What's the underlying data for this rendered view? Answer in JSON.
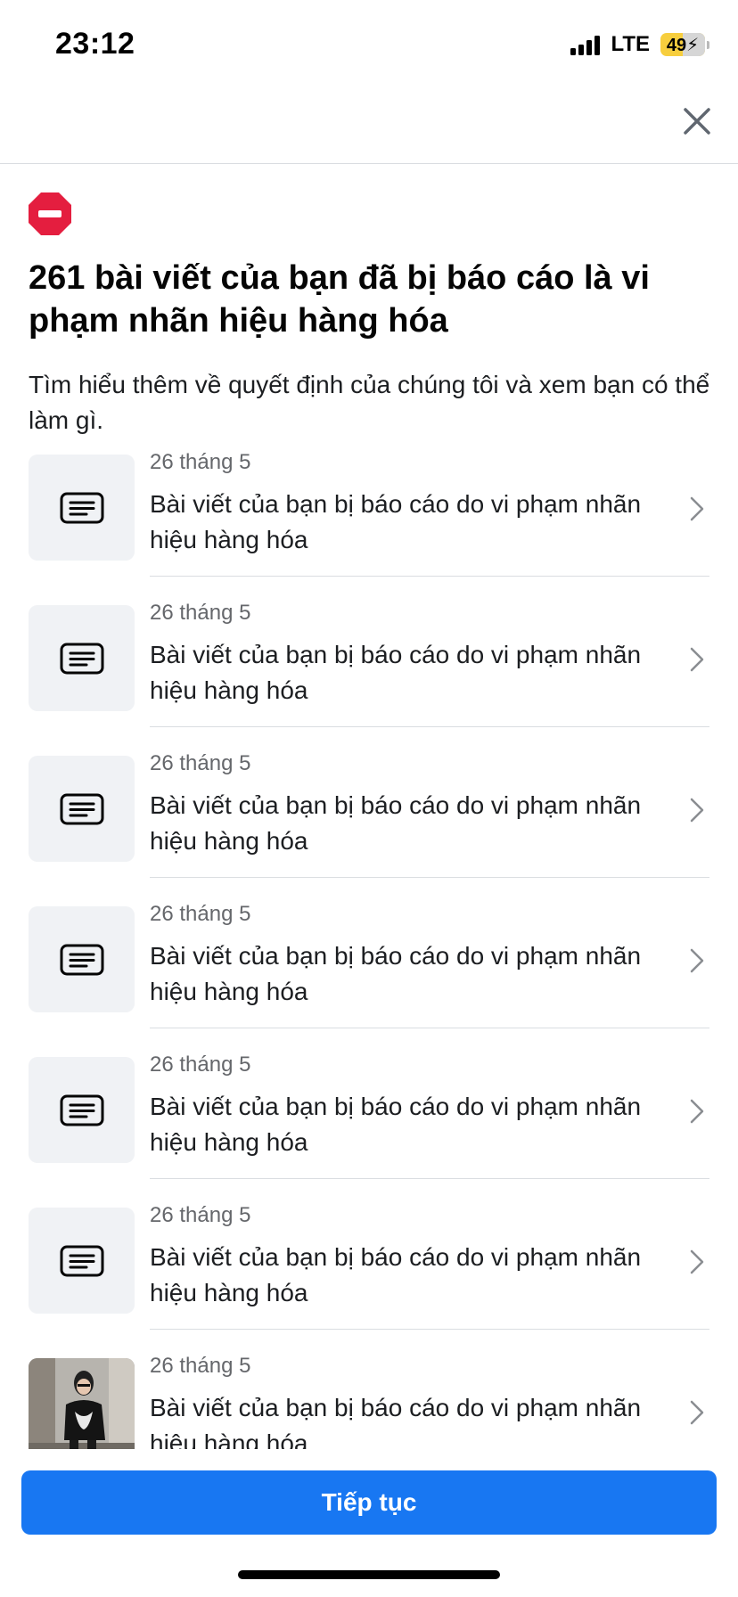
{
  "status_bar": {
    "time": "23:12",
    "network": "LTE",
    "battery_level": "49",
    "battery_fraction": 0.49,
    "battery_color": "#f7ce3e"
  },
  "header": {
    "close_icon": "close-icon"
  },
  "notice": {
    "icon": "stop-icon",
    "icon_color": "#e41e3f",
    "title": "261 bài viết của bạn đã bị báo cáo là vi phạm nhãn hiệu hàng hóa",
    "subtitle": "Tìm hiểu thêm về quyết định của chúng tôi và xem bạn có thể làm gì."
  },
  "items": [
    {
      "date": "26 tháng 5",
      "description": "Bài viết của bạn bị báo cáo do vi phạm nhãn hiệu hàng hóa",
      "thumb": "post-icon"
    },
    {
      "date": "26 tháng 5",
      "description": "Bài viết của bạn bị báo cáo do vi phạm nhãn hiệu hàng hóa",
      "thumb": "post-icon"
    },
    {
      "date": "26 tháng 5",
      "description": "Bài viết của bạn bị báo cáo do vi phạm nhãn hiệu hàng hóa",
      "thumb": "post-icon"
    },
    {
      "date": "26 tháng 5",
      "description": "Bài viết của bạn bị báo cáo do vi phạm nhãn hiệu hàng hóa",
      "thumb": "post-icon"
    },
    {
      "date": "26 tháng 5",
      "description": "Bài viết của bạn bị báo cáo do vi phạm nhãn hiệu hàng hóa",
      "thumb": "post-icon"
    },
    {
      "date": "26 tháng 5",
      "description": "Bài viết của bạn bị báo cáo do vi phạm nhãn hiệu hàng hóa",
      "thumb": "post-icon"
    },
    {
      "date": "26 tháng 5",
      "description": "Bài viết của bạn bị báo cáo do vi phạm nhãn hiệu hàng hóa",
      "thumb": "photo"
    }
  ],
  "footer": {
    "continue_label": "Tiếp tục",
    "button_color": "#1877f2"
  }
}
